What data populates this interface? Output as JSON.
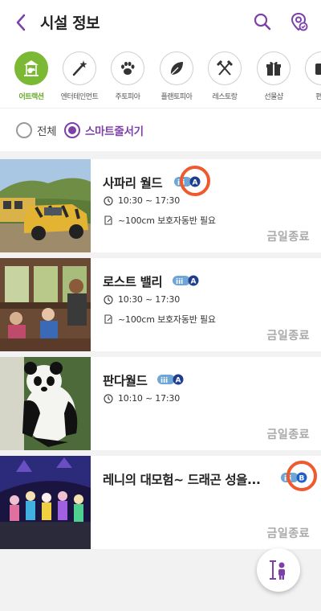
{
  "header": {
    "title": "시설 정보",
    "accent": "#7d3fa8"
  },
  "categories": [
    {
      "label": "어트랙션",
      "icon": "carousel-icon",
      "active": true
    },
    {
      "label": "엔터테인먼트",
      "icon": "magic-wand-icon",
      "active": false
    },
    {
      "label": "주토피아",
      "icon": "paw-icon",
      "active": false
    },
    {
      "label": "플랜토피아",
      "icon": "leaf-icon",
      "active": false
    },
    {
      "label": "레스토랑",
      "icon": "utensils-icon",
      "active": false
    },
    {
      "label": "선물샵",
      "icon": "gift-icon",
      "active": false
    },
    {
      "label": "편의",
      "icon": "convenience-icon",
      "active": false
    }
  ],
  "filter": {
    "all_label": "전체",
    "smart_label": "스마트줄서기",
    "selected": "smart"
  },
  "facilities": [
    {
      "name": "사파리 월드",
      "badge": "A",
      "time": "10:30 ~ 17:30",
      "note": "~100cm 보호자동반 필요",
      "status": "금일종료"
    },
    {
      "name": "로스트 밸리",
      "badge": "A",
      "time": "10:30 ~ 17:30",
      "note": "~100cm 보호자동반 필요",
      "status": "금일종료"
    },
    {
      "name": "판다월드",
      "badge": "A",
      "time": "10:10 ~ 17:30",
      "note": "",
      "status": "금일종료"
    },
    {
      "name": "레니의 대모험~ 드래곤 성을...",
      "badge": "B",
      "time": "",
      "note": "",
      "status": "금일종료"
    }
  ],
  "colors": {
    "brand_green": "#7bb934",
    "brand_purple": "#7d3fa8",
    "highlight": "#ee5a2e",
    "badge_navy": "#1f3d8f",
    "badge_light": "#6fa6d8"
  }
}
